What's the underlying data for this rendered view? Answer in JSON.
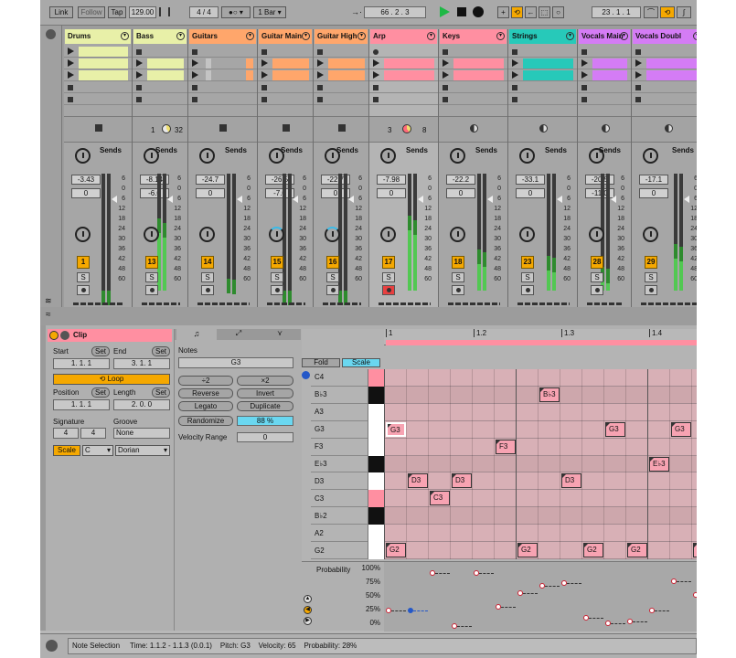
{
  "toolbar": {
    "link": "Link",
    "follow": "Follow",
    "tap": "Tap",
    "tempo": "129.00",
    "sig": "4 / 4",
    "metro": "1 Bar",
    "position": "66 .  2 .  3",
    "loop_pos": "23 .  1 .  1"
  },
  "tracks": [
    {
      "name": "Drums",
      "color": "#e8f0a8",
      "num": "1",
      "vol": "-3.43",
      "pan": "0",
      "meter": 0
    },
    {
      "name": "Bass",
      "color": "#e8f0a8",
      "num": "13",
      "vol": "-8.14",
      "pan": "-6.0",
      "meter": 0.62,
      "extra": "1",
      "extra2": "32"
    },
    {
      "name": "Guitars",
      "color": "#ffa66b",
      "num": "14",
      "vol": "-24.7",
      "pan": "0",
      "meter": 0.1
    },
    {
      "name": "Guitar Main",
      "color": "#ffa66b",
      "num": "15",
      "vol": "-26.5",
      "pan": "-7.0",
      "meter": 0
    },
    {
      "name": "Guitar High",
      "color": "#ffa66b",
      "num": "16",
      "vol": "-22.7",
      "pan": "0",
      "meter": 0
    },
    {
      "name": "Arp",
      "color": "#ff8fa1",
      "num": "17",
      "vol": "-7.98",
      "pan": "0",
      "meter": 0.64,
      "extra": "3",
      "extra2": "8"
    },
    {
      "name": "Keys",
      "color": "#ff8fa1",
      "num": "18",
      "vol": "-22.2",
      "pan": "0",
      "meter": 0.35
    },
    {
      "name": "Strings",
      "color": "#27c9b9",
      "num": "23",
      "vol": "-33.1",
      "pan": "0",
      "meter": 0.3
    },
    {
      "name": "Vocals Main",
      "color": "#d47cf5",
      "num": "28",
      "vol": "-20.5",
      "pan": "-11.0",
      "meter": 0.2
    },
    {
      "name": "Vocals Doubl",
      "color": "#d47cf5",
      "num": "29",
      "vol": "-17.1",
      "pan": "0",
      "meter": 0.4
    }
  ],
  "sends_label": "Sends",
  "solo_label": "S",
  "meter_scale": [
    "6",
    "0",
    "6",
    "12",
    "18",
    "24",
    "30",
    "36",
    "42",
    "48",
    "60"
  ],
  "clip": {
    "title": "Clip",
    "start_label": "Start",
    "end_label": "End",
    "set_label": "Set",
    "start": "1.   1.   1",
    "end": "3.   1.   1",
    "loop_label": "Loop",
    "position_label": "Position",
    "length_label": "Length",
    "position": "1.   1.   1",
    "length": "2.   0.   0",
    "signature_label": "Signature",
    "groove_label": "Groove",
    "sig_num": "4",
    "sig_den": "4",
    "groove": "None",
    "scale_label": "Scale",
    "scale_root": "C",
    "scale_mode": "Dorian"
  },
  "notes_panel": {
    "title": "Notes",
    "note": "G3",
    "div2": "÷2",
    "mul2": "×2",
    "reverse": "Reverse",
    "invert": "Invert",
    "legato": "Legato",
    "duplicate": "Duplicate",
    "randomize": "Randomize",
    "rand_value": "88 %",
    "vel_range_label": "Velocity Range",
    "vel_range": "0"
  },
  "piano": {
    "fold": "Fold",
    "scale": "Scale",
    "keys": [
      "C4",
      "B♭3",
      "A3",
      "G3",
      "F3",
      "E♭3",
      "D3",
      "C3",
      "B♭2",
      "A2",
      "G2"
    ],
    "ruler": [
      "1",
      "1.2",
      "1.3",
      "1.4"
    ]
  },
  "notes": [
    {
      "label": "G3",
      "row": 3,
      "start": 0,
      "len": 1
    },
    {
      "label": "D3",
      "row": 6,
      "start": 1,
      "len": 1
    },
    {
      "label": "C3",
      "row": 7,
      "start": 2,
      "len": 1
    },
    {
      "label": "D3",
      "row": 6,
      "start": 3,
      "len": 1
    },
    {
      "label": "F3",
      "row": 4,
      "start": 5,
      "len": 1
    },
    {
      "label": "B♭3",
      "row": 1,
      "start": 7,
      "len": 1
    },
    {
      "label": "D3",
      "row": 6,
      "start": 8,
      "len": 1
    },
    {
      "label": "G3",
      "row": 3,
      "start": 10,
      "len": 1
    },
    {
      "label": "E♭3",
      "row": 5,
      "start": 12,
      "len": 1
    },
    {
      "label": "G3",
      "row": 3,
      "start": 13,
      "len": 1
    },
    {
      "label": "G2",
      "row": 10,
      "start": 0,
      "len": 1
    },
    {
      "label": "G2",
      "row": 10,
      "start": 6,
      "len": 1
    },
    {
      "label": "G2",
      "row": 10,
      "start": 9,
      "len": 1
    },
    {
      "label": "G2",
      "row": 10,
      "start": 11,
      "len": 1
    },
    {
      "label": "G2",
      "row": 10,
      "start": 14,
      "len": 0.3
    }
  ],
  "probability": {
    "label": "Probability",
    "ticks": [
      "100%",
      "75%",
      "50%",
      "25%",
      "0%"
    ],
    "values": [
      0.28,
      0.28,
      0.92,
      0.02,
      0.92,
      0.35,
      0.58,
      0.7,
      0.75,
      0.15,
      0.06,
      0.1,
      0.28,
      0.78,
      0.55
    ]
  },
  "status": {
    "label": "Note Selection",
    "time": "Time: 1.1.2 - 1.1.3 (0.0.1)",
    "pitch": "Pitch: G3",
    "velocity": "Velocity: 65",
    "probability": "Probability: 28%"
  }
}
